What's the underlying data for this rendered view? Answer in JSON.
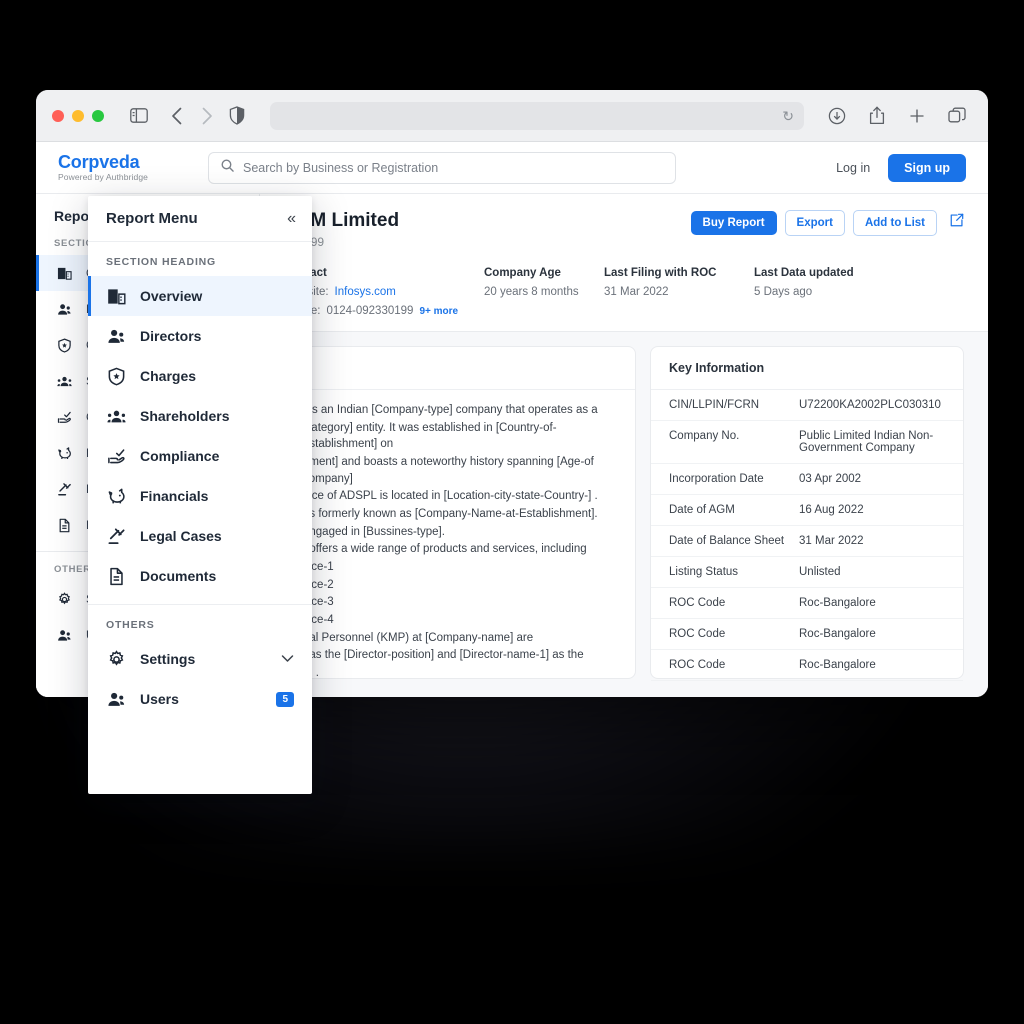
{
  "browser": {
    "url_value": "",
    "icons": [
      "sidebar-toggle-icon",
      "back-icon",
      "forward-icon",
      "shield-icon",
      "reload-icon",
      "download-icon",
      "share-icon",
      "new-tab-icon",
      "tab-overview-icon"
    ]
  },
  "app_header": {
    "brand_name": "Corpveda",
    "brand_sub": "Powered by Authbridge",
    "search_placeholder": "Search by Business or Registration",
    "login_label": "Log in",
    "signup_label": "Sign up"
  },
  "rail": {
    "title": "Report",
    "section_label": "SECTION",
    "items": [
      {
        "label": "Overview",
        "icon": "building-icon"
      },
      {
        "label": "Directors",
        "icon": "people-icon"
      },
      {
        "label": "Charges",
        "icon": "shield-star-icon"
      },
      {
        "label": "Shareholders",
        "icon": "group-icon"
      },
      {
        "label": "Compliance",
        "icon": "hand-check-icon"
      },
      {
        "label": "Financials",
        "icon": "piggy-bank-icon"
      },
      {
        "label": "Legal Cases",
        "icon": "gavel-icon"
      },
      {
        "label": "Documents",
        "icon": "document-icon"
      }
    ],
    "others_label": "OTHERS",
    "others": [
      {
        "label": "Settings",
        "icon": "gear-icon"
      },
      {
        "label": "Users",
        "icon": "users-icon"
      }
    ]
  },
  "popover": {
    "title": "Report Menu",
    "collapse_icon": "«",
    "section_label": "SECTION HEADING",
    "items": [
      {
        "label": "Overview",
        "icon": "building-icon",
        "active": true
      },
      {
        "label": "Directors",
        "icon": "people-icon",
        "active": false
      },
      {
        "label": "Charges",
        "icon": "shield-star-icon",
        "active": false
      },
      {
        "label": "Shareholders",
        "icon": "group-icon",
        "active": false
      },
      {
        "label": "Compliance",
        "icon": "hand-check-icon",
        "active": false
      },
      {
        "label": "Financials",
        "icon": "piggy-bank-icon",
        "active": false
      },
      {
        "label": "Legal Cases",
        "icon": "gavel-icon",
        "active": false
      },
      {
        "label": "Documents",
        "icon": "document-icon",
        "active": false
      }
    ],
    "others_label": "OTHERS",
    "settings_label": "Settings",
    "settings_chevron": "⌄",
    "users_label": "Users",
    "users_badge": "5"
  },
  "company": {
    "name": "BPM Limited",
    "cin_partial": "787899",
    "buy_report": "Buy Report",
    "export": "Export",
    "add_to_list": "Add to List",
    "facts": {
      "contact_label": "Contact",
      "website_key": "Website:",
      "website_value": "Infosys.com",
      "phone_key": "Phone:",
      "phone_value": "0124-092330199",
      "more_label": "9+ more",
      "age_label": "Company Age",
      "age_value": "20 years 8 months",
      "filing_label": "Last Filing with ROC",
      "filing_value": "31 Mar 2022",
      "updated_label": "Last Data updated",
      "updated_value": "5 Days ago"
    }
  },
  "description": {
    "lines": [
      "] is an Indian [Company-type] company that operates as a",
      "Category]  entity. It was established in [Country-of-establishment] on",
      "hment] and boasts a noteworthy history spanning [Age-of company]",
      "ffice of ADSPL is located in  [Location-city-state-Country-] .",
      "as formerly known as [Company-Name-at-Establishment].",
      "engaged in [Bussines-type].",
      "] offers a wide range of products and services, including",
      "vice-1",
      "vice-2",
      "vice-3",
      "vice-4",
      "rial Personnel (KMP) at [Company-name] are",
      "] as the [Director-position] and [Director-name-1] as the",
      "n] ."
    ]
  },
  "key_information": {
    "title": "Key Information",
    "rows": [
      {
        "key": "CIN/LLPIN/FCRN",
        "value": "U72200KA2002PLC030310"
      },
      {
        "key": "Company No.",
        "value": "Public Limited Indian Non-Government Company"
      },
      {
        "key": "Incorporation Date",
        "value": "03 Apr 2002"
      },
      {
        "key": "Date of AGM",
        "value": "16 Aug 2022"
      },
      {
        "key": "Date of Balance Sheet",
        "value": "31 Mar 2022"
      },
      {
        "key": "Listing Status",
        "value": "Unlisted"
      },
      {
        "key": "ROC Code",
        "value": "Roc-Bangalore"
      },
      {
        "key": "ROC Code",
        "value": "Roc-Bangalore"
      },
      {
        "key": "ROC Code",
        "value": "Roc-Bangalore"
      }
    ]
  },
  "colors": {
    "accent": "#1a73e8",
    "active_bg": "#eef5fe",
    "page_bg": "#f7f8fa"
  }
}
